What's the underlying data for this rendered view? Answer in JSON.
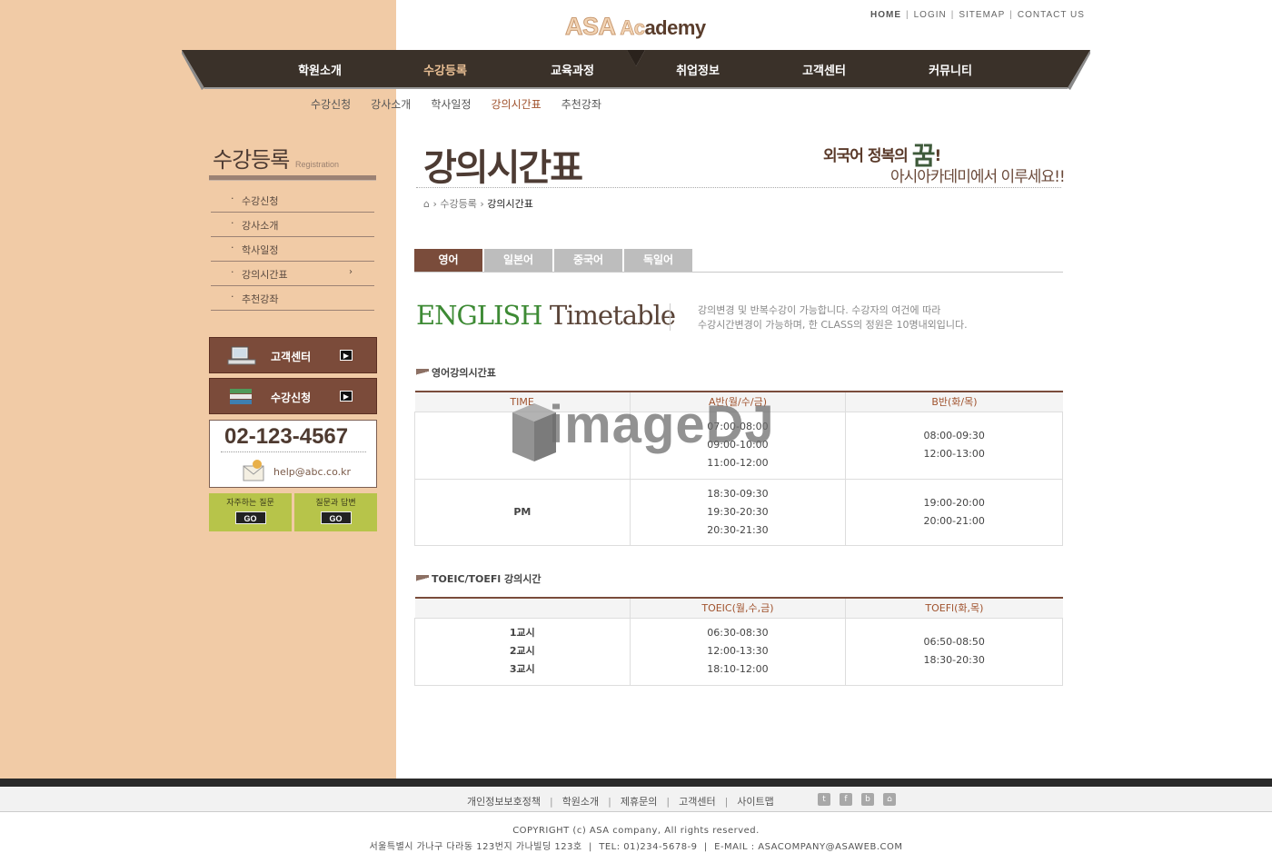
{
  "logo": {
    "text_a": "ASA",
    "text_b": "Ac",
    "text_c": "ademy"
  },
  "top_links": [
    "HOME",
    "LOGIN",
    "SITEMAP",
    "CONTACT US"
  ],
  "main_nav": [
    "학원소개",
    "수강등록",
    "교육과정",
    "취업정보",
    "고객센터",
    "커뮤니티"
  ],
  "main_nav_active": "수강등록",
  "sub_nav": [
    "수강신청",
    "강사소개",
    "학사일정",
    "강의시간표",
    "추천강좌"
  ],
  "sub_nav_active": "강의시간표",
  "sidebar": {
    "title": "수강등록",
    "title_en": "Registration",
    "items": [
      "수강신청",
      "강사소개",
      "학사일정",
      "강의시간표",
      "추천강좌"
    ],
    "active_item_arrow": "›",
    "customer_btn": "고객센터",
    "apply_btn": "수강신청",
    "phone": "02-123-4567",
    "email": "help@abc.co.kr",
    "faq_label": "자주하는 질문",
    "qna_label": "질문과 답변",
    "go_label": "GO"
  },
  "page": {
    "title": "강의시간표",
    "slogan_1a": "외국어 정복의",
    "slogan_big": "꿈",
    "slogan_1b": "!",
    "slogan_2": "아시아카데미에서 이루세요!!",
    "breadcrumb": [
      "수강등록",
      "강의시간표"
    ],
    "tabs": [
      "영어",
      "일본어",
      "중국어",
      "독일어"
    ],
    "active_tab": "영어",
    "eng_title_a": "ENGLISH",
    "eng_title_b": "Timetable",
    "notice_1": "강의변경 및 반복수강이 가능합니다. 수강자의 여건에 따라",
    "notice_2": "수강시간변경이 가능하며, 한 CLASS의 정원은 10명내외입니다."
  },
  "table1": {
    "heading": "영어강의시간표",
    "headers": [
      "TIME",
      "A반(월/수/금)",
      "B반(화/목)"
    ],
    "rows": [
      {
        "label": "",
        "a": [
          "07:00-08:00",
          "09:00-10:00",
          "11:00-12:00"
        ],
        "b": [
          "08:00-09:30",
          "12:00-13:00"
        ]
      },
      {
        "label": "PM",
        "a": [
          "18:30-09:30",
          "19:30-20:30",
          "20:30-21:30"
        ],
        "b": [
          "19:00-20:00",
          "20:00-21:00"
        ]
      }
    ]
  },
  "table2": {
    "heading": "TOEIC/TOEFl 강의시간",
    "headers": [
      "",
      "TOEIC(월,수,금)",
      "TOEFl(화,목)"
    ],
    "rows": [
      {
        "labels": [
          "1교시",
          "2교시",
          "3교시"
        ],
        "a": [
          "06:30-08:30",
          "12:00-13:30",
          "18:10-12:00"
        ],
        "b": [
          "06:50-08:50",
          "18:30-20:30"
        ]
      }
    ]
  },
  "watermark": "imageDJ",
  "footer": {
    "links": [
      "개인정보보호정책",
      "학원소개",
      "제휴문의",
      "고객센터",
      "사이트맵"
    ],
    "social_icons": [
      "twitter-icon",
      "facebook-icon",
      "blog-icon",
      "home-icon"
    ],
    "copyright": "COPYRIGHT (c) ASA company, All rights reserved.",
    "address": "서울특별시 가나구 다라동 123번지 가나빌딩 123호",
    "tel": "TEL: 01)234-5678-9",
    "email": "E-MAIL : ASACOMPANY@ASAWEB.COM"
  },
  "colors": {
    "accent": "#7a4c3b",
    "left_bg": "#f1cba6",
    "nav_dark": "#3a3129",
    "green": "#b7c44a"
  }
}
